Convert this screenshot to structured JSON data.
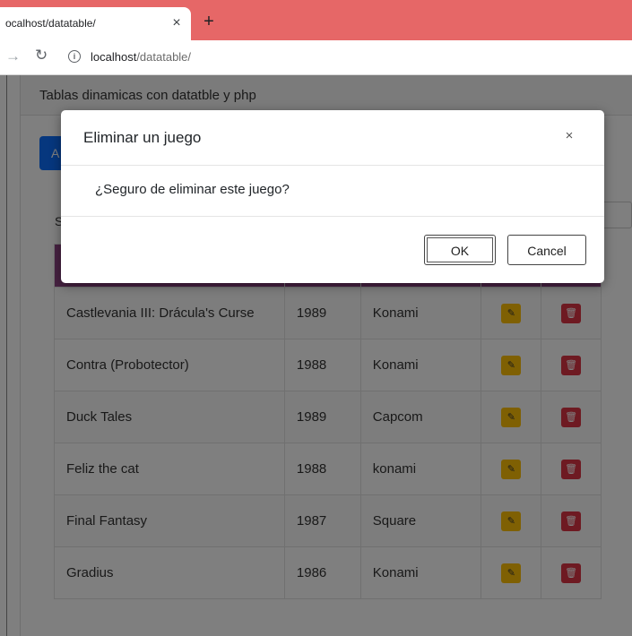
{
  "browser": {
    "tab_title": "ocalhost/datatable/",
    "tab_close": "×",
    "new_tab": "+",
    "url_host": "localhost",
    "url_path": "/datatable/"
  },
  "page": {
    "card_title": "Tablas dinamicas con datatble y php",
    "add_button_label": "A",
    "search_label": "S"
  },
  "table": {
    "rows": [
      {
        "title": "Castlevania III: Drácula's Curse",
        "year": "1989",
        "studio": "Konami"
      },
      {
        "title": "Contra (Probotector)",
        "year": "1988",
        "studio": "Konami"
      },
      {
        "title": "Duck Tales",
        "year": "1989",
        "studio": "Capcom"
      },
      {
        "title": "Feliz the cat",
        "year": "1988",
        "studio": "konami"
      },
      {
        "title": "Final Fantasy",
        "year": "1987",
        "studio": "Square"
      },
      {
        "title": "Gradius",
        "year": "1986",
        "studio": "Konami"
      }
    ]
  },
  "modal": {
    "title": "Eliminar un juego",
    "close": "×",
    "message": "¿Seguro de eliminar este juego?",
    "ok_label": "OK",
    "cancel_label": "Cancel"
  },
  "colors": {
    "tabstrip": "#e66767",
    "table_header": "#8e4585",
    "edit_button": "#ffc107",
    "delete_button": "#dc3545",
    "primary_button": "#0d6efd"
  }
}
